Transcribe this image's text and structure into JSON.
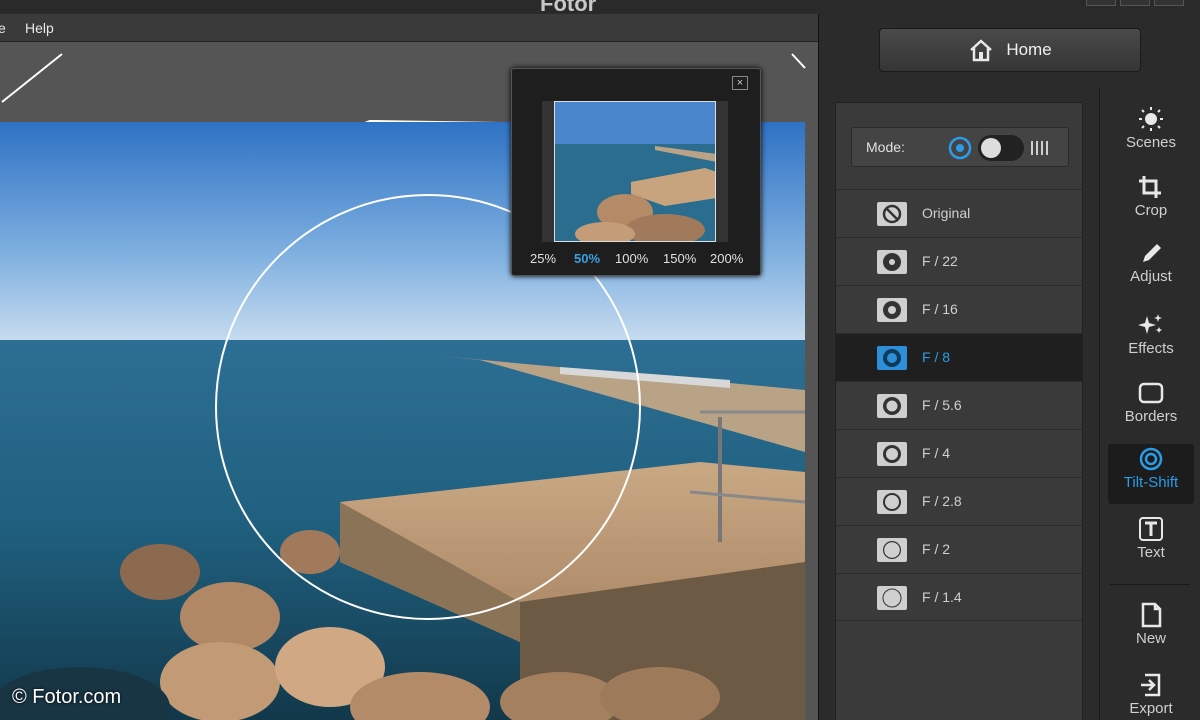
{
  "window": {
    "title": "Fotor"
  },
  "menu": {
    "items": [
      "e",
      "Help"
    ]
  },
  "watermark": "© Fotor.com",
  "navigator": {
    "close_label": "×",
    "zoom_levels": [
      "25%",
      "50%",
      "100%",
      "150%",
      "200%"
    ],
    "active_zoom": "50%"
  },
  "home": {
    "label": "Home"
  },
  "mode": {
    "label": "Mode:",
    "selected": "circular"
  },
  "apertures": {
    "items": [
      "Original",
      "F / 22",
      "F / 16",
      "F / 8",
      "F / 5.6",
      "F / 4",
      "F / 2.8",
      "F / 2",
      "F / 1.4"
    ],
    "selected": "F / 8"
  },
  "tools": {
    "items": [
      {
        "label": "Scenes",
        "icon": "sun-icon"
      },
      {
        "label": "Crop",
        "icon": "crop-icon"
      },
      {
        "label": "Adjust",
        "icon": "pencil-icon"
      },
      {
        "label": "Effects",
        "icon": "sparkles-icon"
      },
      {
        "label": "Borders",
        "icon": "frame-icon"
      },
      {
        "label": "Tilt-Shift",
        "icon": "target-icon"
      },
      {
        "label": "Text",
        "icon": "text-icon"
      },
      {
        "label": "New",
        "icon": "document-icon"
      },
      {
        "label": "Export",
        "icon": "export-icon"
      }
    ],
    "active": "Tilt-Shift"
  },
  "colors": {
    "accent": "#2c9ce8",
    "panel": "#3a3a3a",
    "selected_row": "#1f1f1f"
  }
}
